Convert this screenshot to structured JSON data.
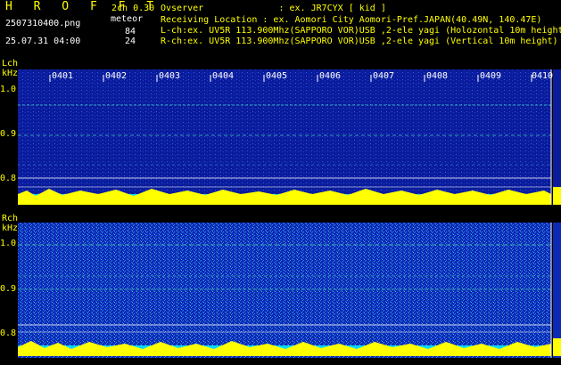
{
  "header": {
    "logo": "H R O F F T",
    "filename": "2507310400.png",
    "datetime": "25.07.31 04:00",
    "version": "2ch 0.30",
    "meteor_label": "meteor",
    "count_l": "84",
    "count_r": "24",
    "observer": "Ovserver              : ex. JR7CYX [ kid ]",
    "location": "Receiving Location : ex. Aomori City Aomori-Pref.JAPAN(40.49N, 140.47E)",
    "lch_desc": "L-ch:ex. UV5R 113.900Mhz(SAPPORO VOR)USB ,2-ele yagi (Holozontal 10m height",
    "rch_desc": "R-ch:ex. UV5R 113.900Mhz(SAPPORO VOR)USB ,2-ele yagi (Vertical 10m height)"
  },
  "lch": {
    "label": "Lch",
    "unit": "kHz",
    "ticks": [
      "1.0",
      "0.9",
      "0.8"
    ],
    "time_labels": [
      "0401",
      "0402",
      "0403",
      "0404",
      "0405",
      "0406",
      "0407",
      "0408",
      "0409",
      "0410"
    ]
  },
  "rch": {
    "label": "Rch",
    "unit": "kHz",
    "ticks": [
      "1.0",
      "0.9",
      "0.8"
    ]
  },
  "colors": {
    "yellow": "#ffff00",
    "cyan": "#00e5ff",
    "spectrum_bg": "#0a1aa0",
    "level_fill": "#ffff00"
  }
}
